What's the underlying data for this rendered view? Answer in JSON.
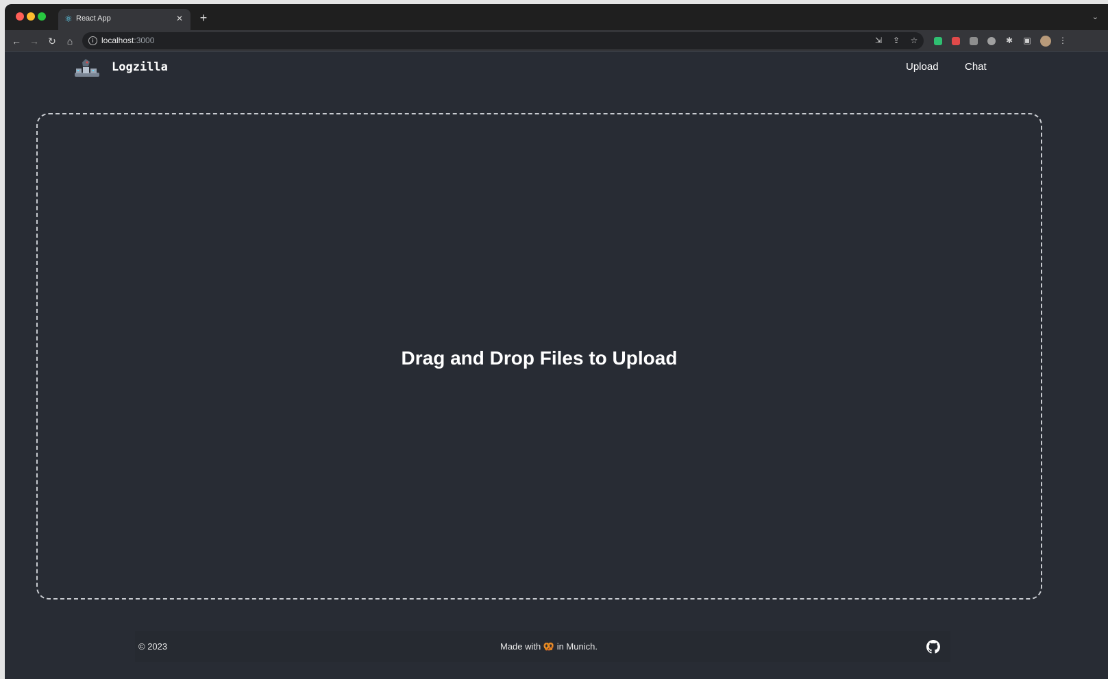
{
  "browser": {
    "tab": {
      "title": "React App",
      "favicon": "react-icon",
      "close_glyph": "✕"
    },
    "new_tab_glyph": "+",
    "tab_menu_glyph": "⌄",
    "nav": {
      "back_glyph": "←",
      "forward_glyph": "→",
      "reload_glyph": "↻",
      "home_glyph": "⌂"
    },
    "url": {
      "host": "localhost",
      "port": ":3000"
    },
    "omnibox_icons": [
      "install-icon",
      "share-icon",
      "bookmark-star-icon"
    ],
    "extension_colors": [
      "#2fbf71",
      "#e04a4a",
      "#8e8e8e",
      "#a0a0a0"
    ]
  },
  "app": {
    "brand": "Logzilla",
    "nav": {
      "upload": "Upload",
      "chat": "Chat"
    },
    "dropzone": {
      "label": "Drag and Drop Files to Upload"
    },
    "footer": {
      "copyright": "© 2023",
      "made_prefix": "Made with",
      "made_emoji": "🥨",
      "made_suffix": "in Munich."
    }
  },
  "colors": {
    "page_background": "#282c34",
    "text": "#ffffff",
    "dropzone_border": "#c9ccd1"
  }
}
